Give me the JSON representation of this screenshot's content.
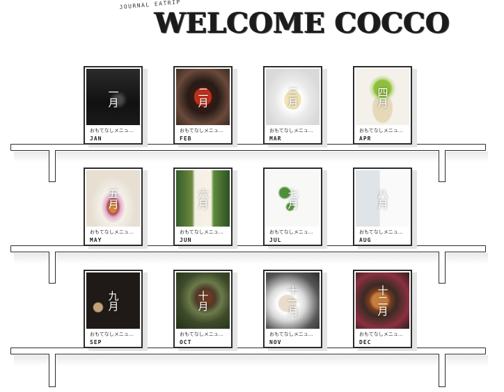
{
  "header": {
    "tagline": "JOURNAL EATRIP",
    "logo": "WELCOME COCCO"
  },
  "cards": [
    {
      "kanji": "一月",
      "menu": "おもてなしメニュ…",
      "month": "JAN"
    },
    {
      "kanji": "二月",
      "menu": "おもてなしメニュ…",
      "month": "FEB"
    },
    {
      "kanji": "三月",
      "menu": "おもてなしメニュ…",
      "month": "MAR"
    },
    {
      "kanji": "四月",
      "menu": "おもてなしメニュ…",
      "month": "APR"
    },
    {
      "kanji": "五月",
      "menu": "おもてなしメニュ…",
      "month": "MAY"
    },
    {
      "kanji": "六月",
      "menu": "おもてなしメニュ…",
      "month": "JUN"
    },
    {
      "kanji": "七月",
      "menu": "おもてなしメニュ…",
      "month": "JUL"
    },
    {
      "kanji": "八月",
      "menu": "おもてなしメニュ…",
      "month": "AUG"
    },
    {
      "kanji": "九月",
      "menu": "おもてなしメニュ…",
      "month": "SEP"
    },
    {
      "kanji": "十月",
      "menu": "おもてなしメニュ…",
      "month": "OCT"
    },
    {
      "kanji": "十一月",
      "menu": "おもてなしメニュ…",
      "month": "NOV"
    },
    {
      "kanji": "十二月",
      "menu": "おもてなしメニュ…",
      "month": "DEC"
    }
  ]
}
